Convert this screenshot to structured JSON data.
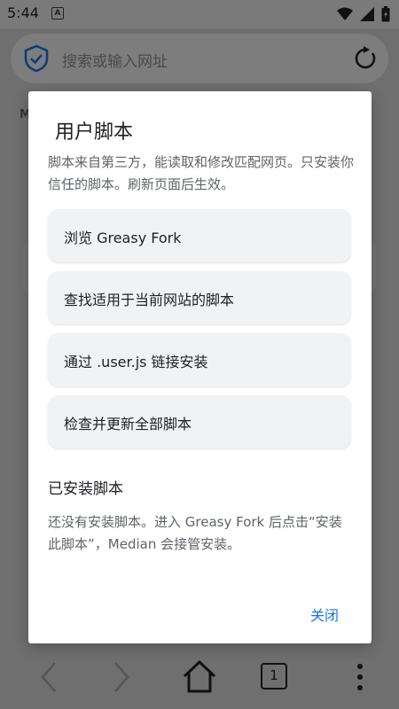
{
  "status_bar": {
    "time": "5:44",
    "notification_letter": "A"
  },
  "browser": {
    "address_placeholder": "搜索或输入网址",
    "background_letter": "M"
  },
  "bottom_nav": {
    "tab_count": "1"
  },
  "dialog": {
    "title": "用户脚本",
    "description": "脚本来自第三方，能读取和修改匹配网页。只安装你信任的脚本。刷新页面后生效。",
    "actions": [
      {
        "label": "浏览 Greasy Fork"
      },
      {
        "label": "查找适用于当前网站的脚本"
      },
      {
        "label": "通过 .user.js 链接安装"
      },
      {
        "label": "检查并更新全部脚本"
      }
    ],
    "installed_title": "已安装脚本",
    "installed_empty": "还没有安装脚本。进入 Greasy Fork 后点击“安装此脚本”，Median 会接管安装。",
    "close_label": "关闭"
  },
  "colors": {
    "accent": "#1a73e8",
    "dim_overlay": "#6f6f6f"
  }
}
